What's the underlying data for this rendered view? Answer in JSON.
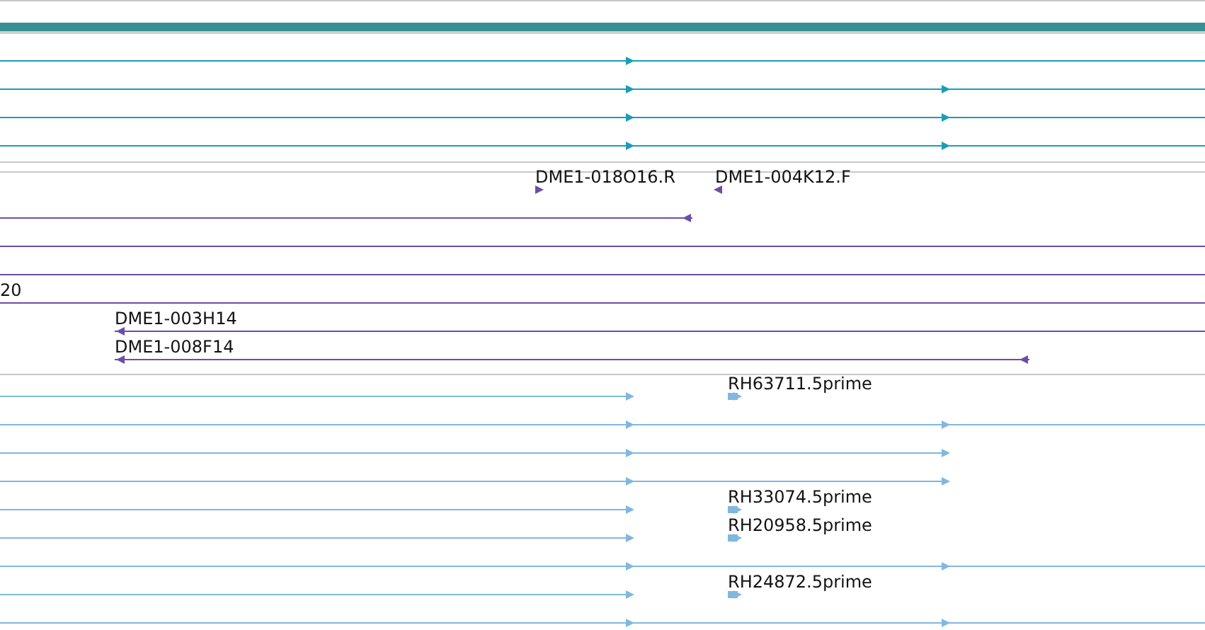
{
  "tracks": [
    {
      "kind": "transcript",
      "rows": [
        {
          "features": [
            {
              "kind": "arrowed",
              "reverse": false
            }
          ]
        },
        {
          "features": [
            {
              "kind": "arrowed",
              "reverse": false
            }
          ]
        },
        {
          "features": [
            {
              "kind": "arrowed",
              "reverse": false
            }
          ]
        },
        {
          "features": [
            {
              "kind": "arrowed",
              "reverse": false
            }
          ]
        }
      ]
    },
    {
      "kind": "clone",
      "rows": [
        {
          "features": [
            {
              "kind": "arrowed",
              "label": "DME1-018O16.R",
              "reverse": false
            },
            {
              "kind": "arrowed",
              "label": "DME1-004K12.F",
              "reverse": true
            }
          ]
        },
        {
          "features": [
            {
              "kind": "arrowed",
              "reverse": true
            }
          ]
        },
        {
          "features": [
            {
              "kind": "plain"
            }
          ]
        },
        {
          "features": [
            {
              "kind": "plain"
            }
          ]
        },
        {
          "features": [
            {
              "kind": "plain",
              "label": "20"
            }
          ]
        },
        {
          "features": [
            {
              "kind": "arrowed",
              "label": "DME1-003H14",
              "reverse": true
            }
          ]
        },
        {
          "features": [
            {
              "kind": "arrowed",
              "label": "DME1-008F14",
              "reverse": true
            }
          ]
        }
      ]
    },
    {
      "kind": "est",
      "rows": [
        {
          "features": [
            {
              "kind": "arrowed",
              "reverse": false
            },
            {
              "kind": "arrowed",
              "label": "RH63711.5prime",
              "reverse": false
            }
          ]
        },
        {
          "features": [
            {
              "kind": "arrowed",
              "reverse": false
            }
          ]
        },
        {
          "features": [
            {
              "kind": "arrowed",
              "reverse": false
            }
          ]
        },
        {
          "features": [
            {
              "kind": "arrowed",
              "reverse": false
            }
          ]
        },
        {
          "features": [
            {
              "kind": "arrowed",
              "reverse": false
            },
            {
              "kind": "arrowed",
              "label": "RH33074.5prime",
              "reverse": false
            }
          ]
        },
        {
          "features": [
            {
              "kind": "arrowed",
              "reverse": false
            },
            {
              "kind": "arrowed",
              "label": "RH20958.5prime",
              "reverse": false
            }
          ]
        },
        {
          "features": [
            {
              "kind": "arrowed",
              "reverse": false
            }
          ]
        },
        {
          "features": [
            {
              "kind": "arrowed",
              "reverse": false
            },
            {
              "kind": "arrowed",
              "label": "RH24872.5prime",
              "reverse": false
            }
          ]
        },
        {
          "features": [
            {
              "kind": "arrowed",
              "reverse": false
            }
          ]
        }
      ]
    }
  ]
}
